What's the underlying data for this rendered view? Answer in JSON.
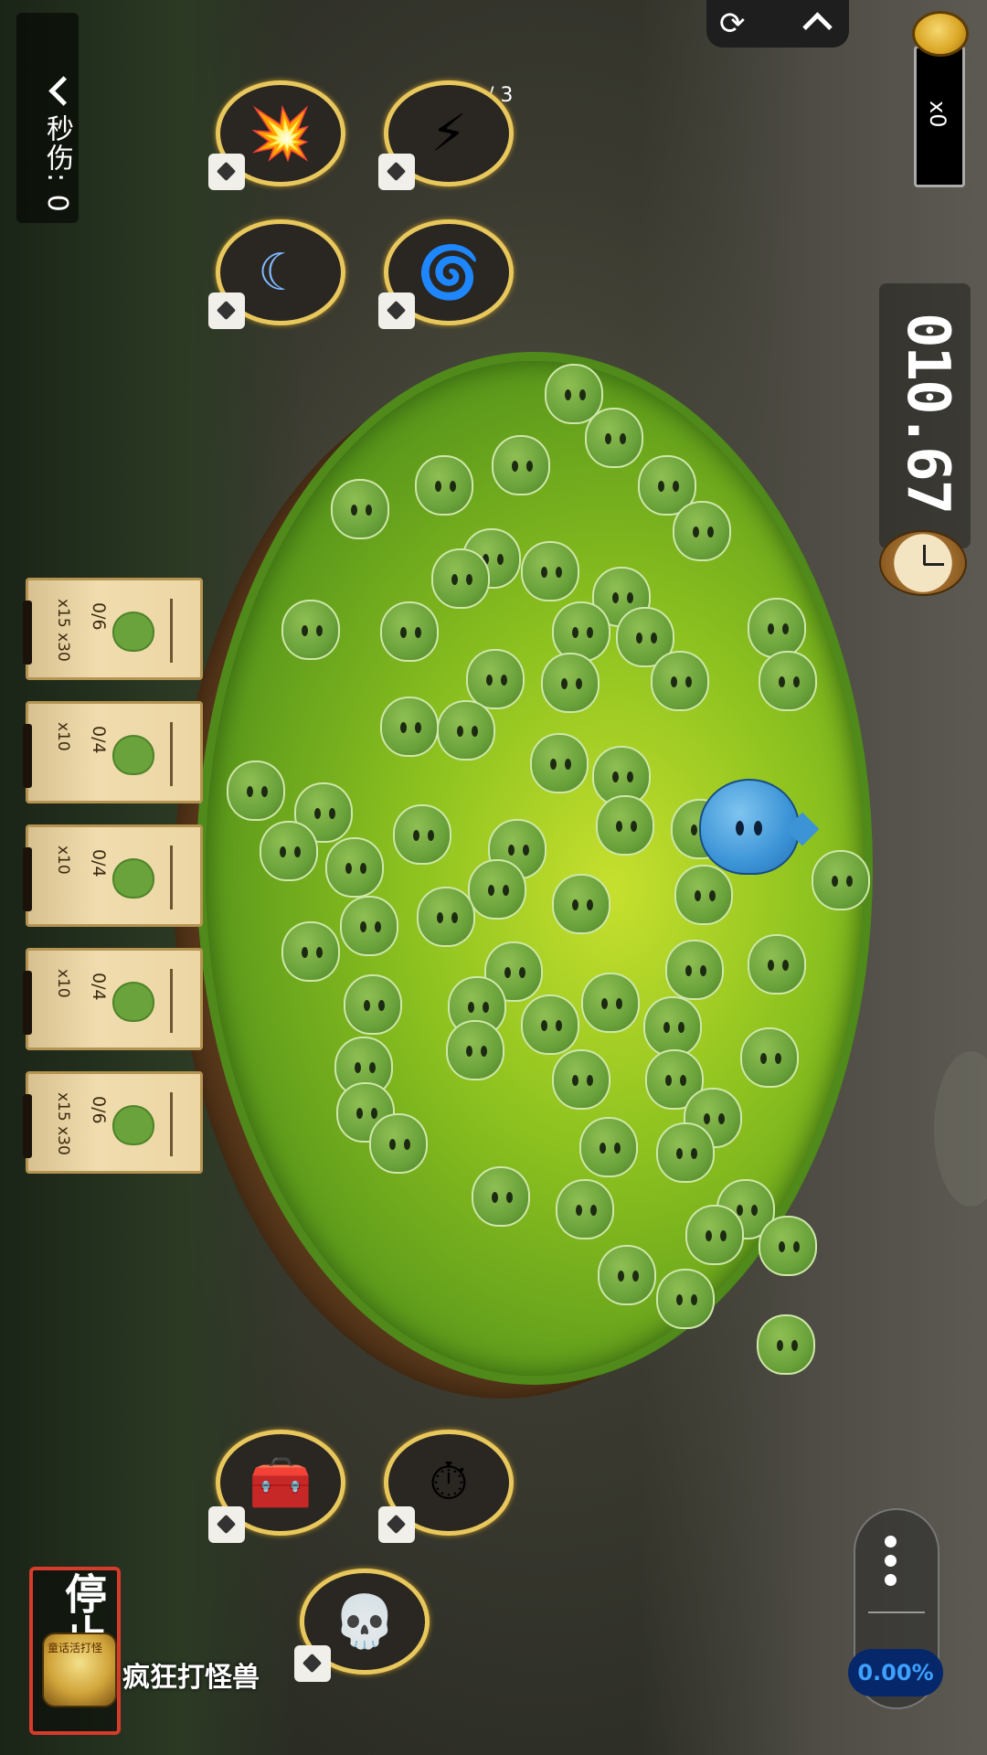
{
  "hud": {
    "dps_label": "秒伤: 0",
    "coin_count": "x0",
    "timer": "010.67",
    "page_indicator": "1 / 3",
    "refresh_icon": "⟳"
  },
  "skills": [
    {
      "name": "explosion-skill-icon",
      "glyph": "💥"
    },
    {
      "name": "lightning-skill-icon",
      "glyph": "⚡"
    },
    {
      "name": "crescent-slash-skill-icon",
      "glyph": "☾"
    },
    {
      "name": "wind-slash-skill-icon",
      "glyph": "🌀"
    },
    {
      "name": "treasure-chest-skill-icon",
      "glyph": "🧰"
    },
    {
      "name": "stopwatch-skill-icon",
      "glyph": "⏱"
    },
    {
      "name": "skull-skill-icon",
      "glyph": "💀"
    }
  ],
  "quests": [
    {
      "progress": "0/6",
      "reward1": "x15",
      "reward2": "x30"
    },
    {
      "progress": "0/4",
      "reward1": "x10",
      "reward2": ""
    },
    {
      "progress": "0/4",
      "reward1": "x10",
      "reward2": ""
    },
    {
      "progress": "0/4",
      "reward1": "x10",
      "reward2": ""
    },
    {
      "progress": "0/6",
      "reward1": "x15",
      "reward2": "x30"
    }
  ],
  "bottom": {
    "stop_label": "停止",
    "app_icon_text": "童话活打怪",
    "app_name": "疯狂打怪兽",
    "percent": "0.00%"
  },
  "colors": {
    "timer_text": "#ffffff",
    "stop_border": "#d63b2b",
    "percent_text": "#3da0ff"
  }
}
